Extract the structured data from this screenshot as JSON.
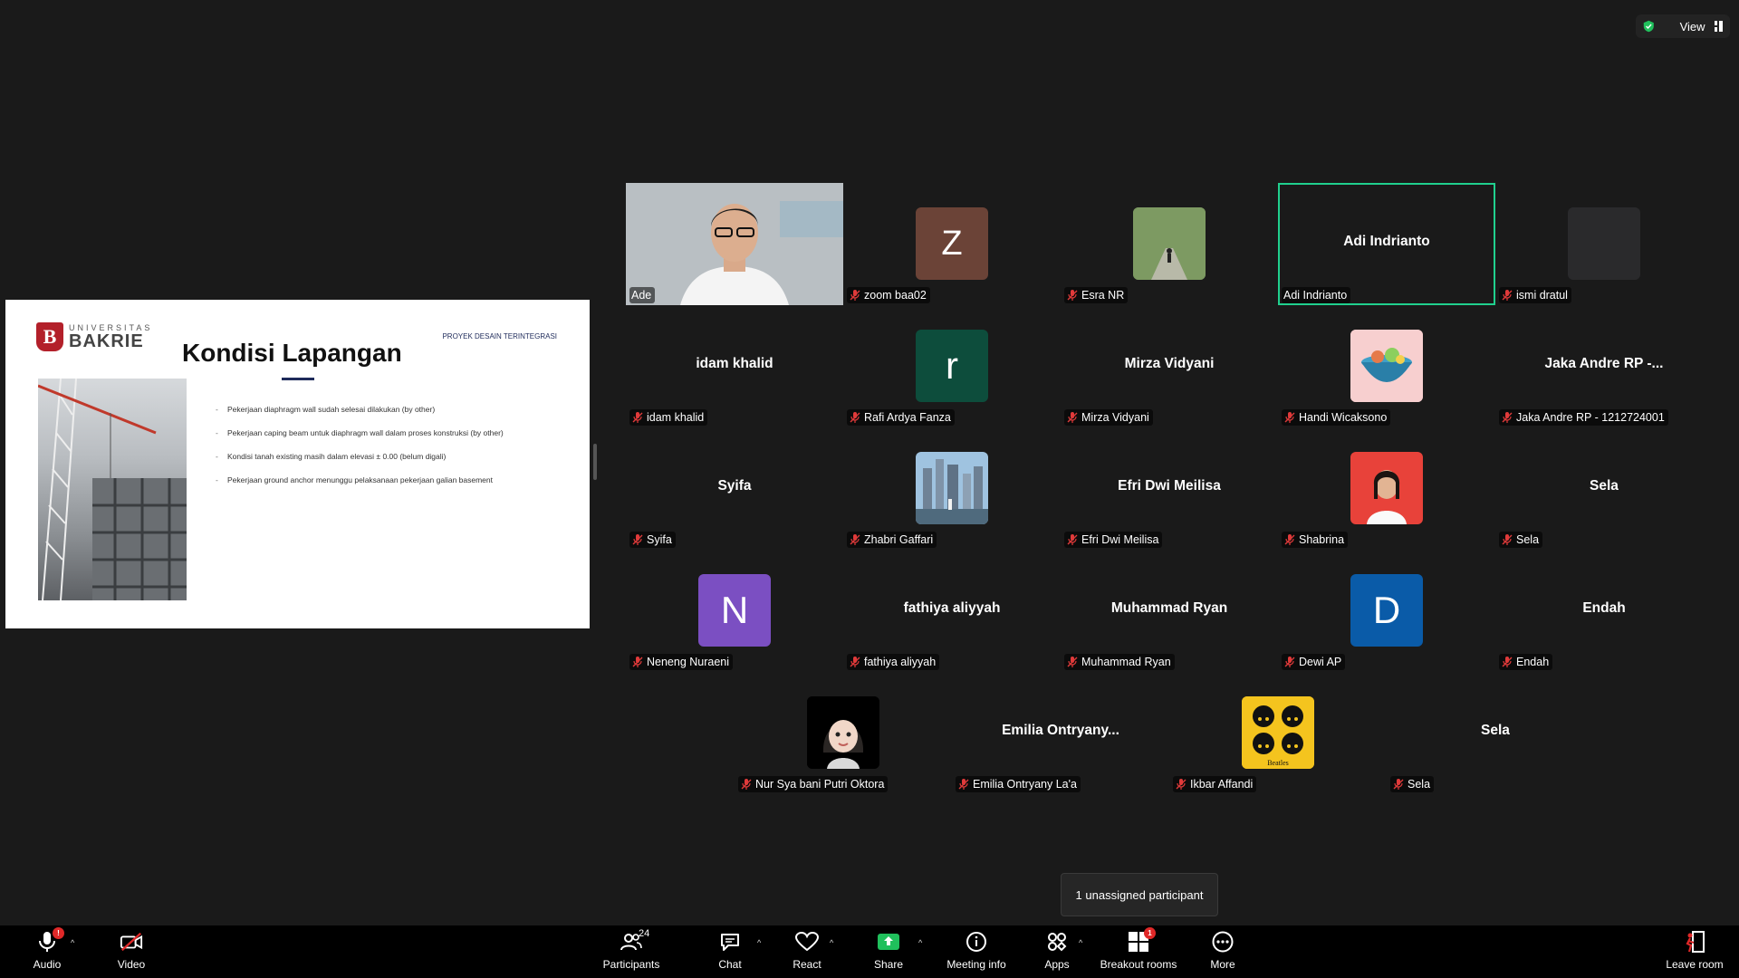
{
  "top_widget": {
    "view_label": "View"
  },
  "slide": {
    "logo_small": "UNIVERSITAS",
    "logo_big": "BAKRIE",
    "logo_letter": "B",
    "title": "Kondisi Lapangan",
    "project_label": "PROYEK DESAIN TERINTEGRASI",
    "bullets": [
      "Pekerjaan diaphragm wall sudah selesai dilakukan (by other)",
      "Pekerjaan caping beam untuk diaphragm wall dalam proses konstruksi (by other)",
      "Kondisi tanah existing masih dalam elevasi ± 0.00 (belum digali)",
      "Pekerjaan ground anchor menunggu pelaksanaan pekerjaan galian basement"
    ]
  },
  "participants": [
    {
      "display": "",
      "label": "Ade",
      "avatar_letter": ""
    },
    {
      "display": "",
      "label": "zoom baa02",
      "avatar_letter": "Z"
    },
    {
      "display": "",
      "label": "Esra NR",
      "avatar_letter": ""
    },
    {
      "display": "Adi Indrianto",
      "label": "Adi Indrianto",
      "avatar_letter": ""
    },
    {
      "display": "",
      "label": "ismi dratul",
      "avatar_letter": ""
    },
    {
      "display": "idam khalid",
      "label": "idam khalid",
      "avatar_letter": ""
    },
    {
      "display": "",
      "label": "Rafi Ardya Fanza",
      "avatar_letter": "r"
    },
    {
      "display": "Mirza Vidyani",
      "label": "Mirza Vidyani",
      "avatar_letter": ""
    },
    {
      "display": "",
      "label": "Handi Wicaksono",
      "avatar_letter": ""
    },
    {
      "display": "Jaka Andre RP -...",
      "label": "Jaka Andre RP - 1212724001",
      "avatar_letter": ""
    },
    {
      "display": "Syifa",
      "label": "Syifa",
      "avatar_letter": ""
    },
    {
      "display": "",
      "label": "Zhabri Gaffari",
      "avatar_letter": ""
    },
    {
      "display": "Efri Dwi Meilisa",
      "label": "Efri Dwi Meilisa",
      "avatar_letter": ""
    },
    {
      "display": "",
      "label": "Shabrina",
      "avatar_letter": ""
    },
    {
      "display": "Sela",
      "label": "Sela",
      "avatar_letter": ""
    },
    {
      "display": "",
      "label": "Neneng Nuraeni",
      "avatar_letter": "N"
    },
    {
      "display": "fathiya aliyyah",
      "label": "fathiya aliyyah",
      "avatar_letter": ""
    },
    {
      "display": "Muhammad Ryan",
      "label": "Muhammad Ryan",
      "avatar_letter": ""
    },
    {
      "display": "",
      "label": "Dewi AP",
      "avatar_letter": "D"
    },
    {
      "display": "Endah",
      "label": "Endah",
      "avatar_letter": ""
    },
    {
      "display": "",
      "label": "Nur Sya bani Putri Oktora",
      "avatar_letter": ""
    },
    {
      "display": "Emilia  Ontryany...",
      "label": "Emilia Ontryany La'a",
      "avatar_letter": ""
    },
    {
      "display": "",
      "label": "Ikbar Affandi",
      "avatar_letter": ""
    },
    {
      "display": "Sela",
      "label": "Sela",
      "avatar_letter": ""
    }
  ],
  "beatles_text": "Beatles",
  "tooltip": "1 unassigned participant",
  "toolbar": {
    "audio": "Audio",
    "audio_badge": "!",
    "video": "Video",
    "participants": "Participants",
    "participants_count": "24",
    "chat": "Chat",
    "react": "React",
    "share": "Share",
    "meeting_info": "Meeting info",
    "apps": "Apps",
    "breakout_rooms": "Breakout rooms",
    "breakout_badge": "1",
    "more": "More",
    "leave": "Leave room"
  },
  "colors": {
    "active_border": "#20d08e",
    "z_avatar": "#6b4337",
    "r_avatar": "#0d4d3c",
    "n_avatar": "#7b4fc2",
    "d_avatar": "#0a5ba8",
    "share_green": "#20c05c"
  }
}
